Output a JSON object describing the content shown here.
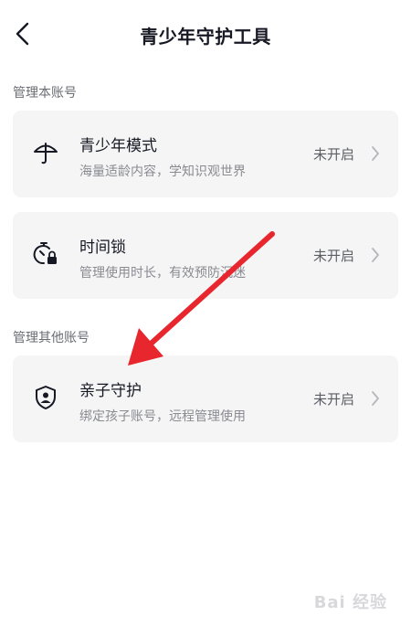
{
  "header": {
    "title": "青少年守护工具",
    "back_icon": "chevron-left-icon"
  },
  "sections": [
    {
      "label": "管理本账号",
      "items": [
        {
          "title": "青少年模式",
          "subtitle": "海量适龄内容，学知识观世界",
          "status": "未开启",
          "icon": "umbrella-icon"
        },
        {
          "title": "时间锁",
          "subtitle": "管理使用时长，有效预防沉迷",
          "status": "未开启",
          "icon": "timer-lock-icon"
        }
      ]
    },
    {
      "label": "管理其他账号",
      "items": [
        {
          "title": "亲子守护",
          "subtitle": "绑定孩子账号，远程管理使用",
          "status": "未开启",
          "icon": "shield-user-icon"
        }
      ]
    }
  ],
  "annotation": {
    "arrow_color": "#e8262d"
  },
  "watermark": {
    "text": "Bai 经验"
  }
}
